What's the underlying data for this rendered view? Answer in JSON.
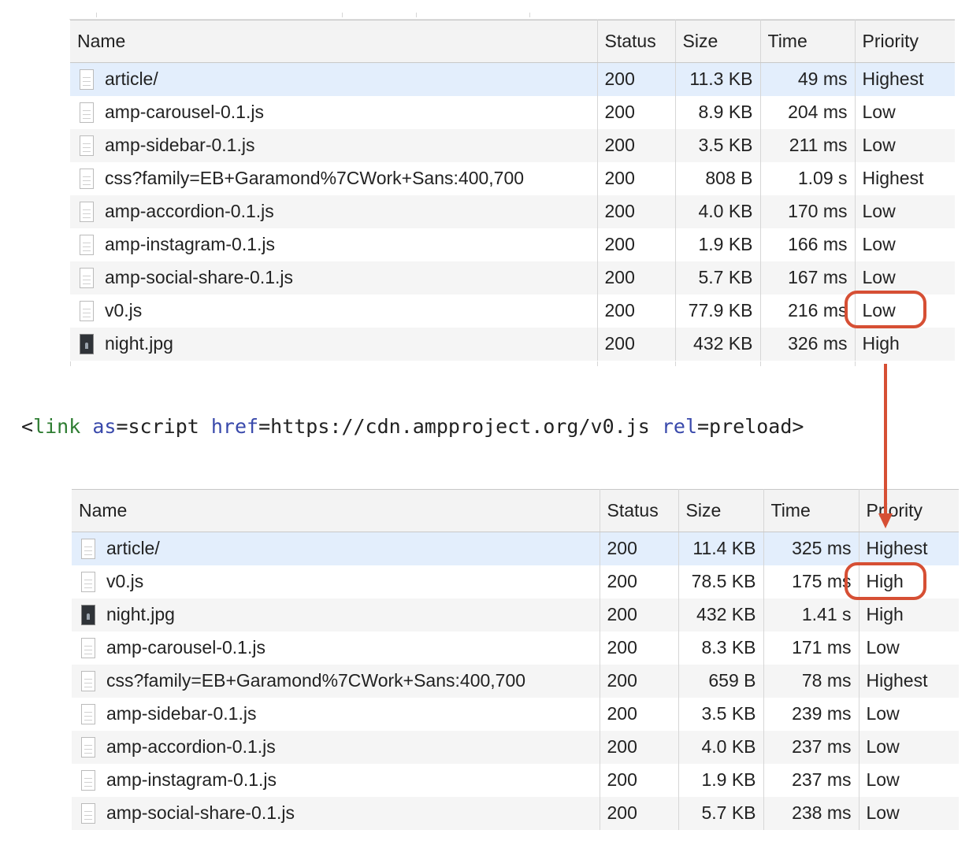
{
  "columns": [
    "Name",
    "Status",
    "Size",
    "Time",
    "Priority"
  ],
  "before_table": {
    "rows": [
      {
        "icon": "document-icon",
        "name": "article/",
        "status": "200",
        "size": "11.3 KB",
        "time": "49 ms",
        "priority": "Highest",
        "selected": true
      },
      {
        "icon": "document-icon",
        "name": "amp-carousel-0.1.js",
        "status": "200",
        "size": "8.9 KB",
        "time": "204 ms",
        "priority": "Low"
      },
      {
        "icon": "document-icon",
        "name": "amp-sidebar-0.1.js",
        "status": "200",
        "size": "3.5 KB",
        "time": "211 ms",
        "priority": "Low"
      },
      {
        "icon": "document-icon",
        "name": "css?family=EB+Garamond%7CWork+Sans:400,700",
        "status": "200",
        "size": "808 B",
        "time": "1.09 s",
        "priority": "Highest"
      },
      {
        "icon": "document-icon",
        "name": "amp-accordion-0.1.js",
        "status": "200",
        "size": "4.0 KB",
        "time": "170 ms",
        "priority": "Low"
      },
      {
        "icon": "document-icon",
        "name": "amp-instagram-0.1.js",
        "status": "200",
        "size": "1.9 KB",
        "time": "166 ms",
        "priority": "Low"
      },
      {
        "icon": "document-icon",
        "name": "amp-social-share-0.1.js",
        "status": "200",
        "size": "5.7 KB",
        "time": "167 ms",
        "priority": "Low"
      },
      {
        "icon": "document-icon",
        "name": "v0.js",
        "status": "200",
        "size": "77.9 KB",
        "time": "216 ms",
        "priority": "Low"
      },
      {
        "icon": "image-icon",
        "name": "night.jpg",
        "status": "200",
        "size": "432 KB",
        "time": "326 ms",
        "priority": "High"
      }
    ]
  },
  "code_snippet": {
    "open": "<",
    "tag": "link",
    "attr1": "as",
    "val1": "=script ",
    "attr2": "href",
    "val2": "=https://cdn.ampproject.org/v0.js ",
    "attr3": "rel",
    "val3": "=preload",
    "close": ">"
  },
  "after_table": {
    "rows": [
      {
        "icon": "document-icon",
        "name": "article/",
        "status": "200",
        "size": "11.4 KB",
        "time": "325 ms",
        "priority": "Highest",
        "selected": true
      },
      {
        "icon": "document-icon",
        "name": "v0.js",
        "status": "200",
        "size": "78.5 KB",
        "time": "175 ms",
        "priority": "High"
      },
      {
        "icon": "image-icon",
        "name": "night.jpg",
        "status": "200",
        "size": "432 KB",
        "time": "1.41 s",
        "priority": "High"
      },
      {
        "icon": "document-icon",
        "name": "amp-carousel-0.1.js",
        "status": "200",
        "size": "8.3 KB",
        "time": "171 ms",
        "priority": "Low"
      },
      {
        "icon": "document-icon",
        "name": "css?family=EB+Garamond%7CWork+Sans:400,700",
        "status": "200",
        "size": "659 B",
        "time": "78 ms",
        "priority": "Highest"
      },
      {
        "icon": "document-icon",
        "name": "amp-sidebar-0.1.js",
        "status": "200",
        "size": "3.5 KB",
        "time": "239 ms",
        "priority": "Low"
      },
      {
        "icon": "document-icon",
        "name": "amp-accordion-0.1.js",
        "status": "200",
        "size": "4.0 KB",
        "time": "237 ms",
        "priority": "Low"
      },
      {
        "icon": "document-icon",
        "name": "amp-instagram-0.1.js",
        "status": "200",
        "size": "1.9 KB",
        "time": "237 ms",
        "priority": "Low"
      },
      {
        "icon": "document-icon",
        "name": "amp-social-share-0.1.js",
        "status": "200",
        "size": "5.7 KB",
        "time": "238 ms",
        "priority": "Low"
      }
    ]
  },
  "annotation": {
    "color": "#d64f34",
    "before_highlight": "v0.js priority cell",
    "after_highlight": "v0.js priority cell"
  },
  "colors": {
    "header_bg": "#f3f3f3",
    "selected_row_bg": "#e3eefc",
    "stripe_bg": "#f5f5f5",
    "code_tag": "#2e7d32",
    "code_attr": "#3949ab"
  }
}
